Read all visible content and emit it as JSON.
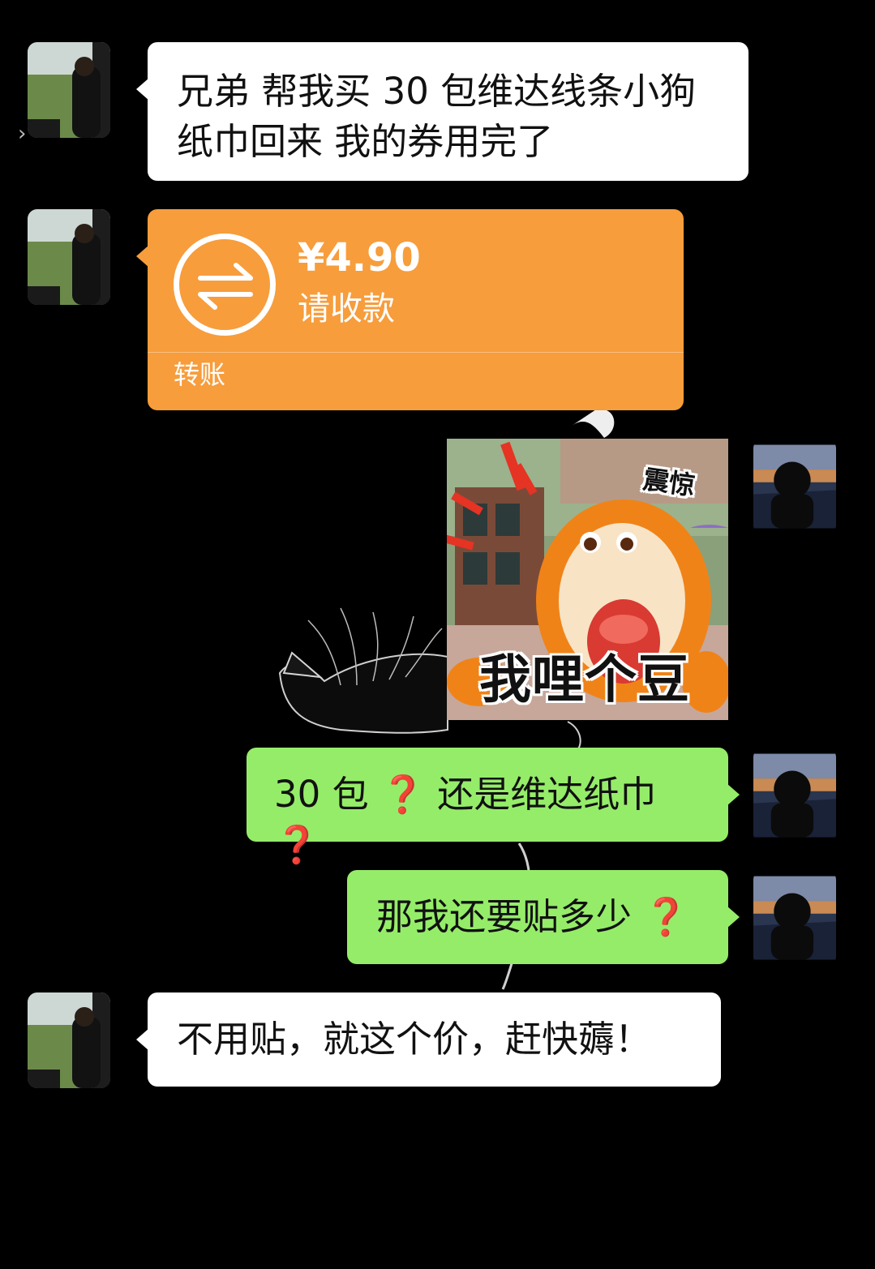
{
  "messages": [
    {
      "id": "m1",
      "side": "left",
      "type": "text",
      "text": "兄弟 帮我买 30 包维达线条小狗\n纸巾回来 我的券用完了"
    },
    {
      "id": "m2",
      "side": "left",
      "type": "transfer",
      "amount": "¥4.90",
      "memo": "请收款",
      "kind": "转账"
    },
    {
      "id": "m3",
      "side": "right",
      "type": "sticker",
      "caption_big": "我哩个豆",
      "caption_small": "震惊"
    },
    {
      "id": "m4",
      "side": "right",
      "type": "text",
      "parts": [
        "30 包",
        "❓",
        "还是维达纸巾",
        "❓"
      ]
    },
    {
      "id": "m5",
      "side": "right",
      "type": "text",
      "parts": [
        "那我还要贴多少",
        "❓"
      ]
    },
    {
      "id": "m6",
      "side": "left",
      "type": "text",
      "text": "不用贴，就这个价，赶快薅！"
    }
  ],
  "colors": {
    "background": "#000000",
    "bubble_incoming": "#ffffff",
    "bubble_outgoing": "#95ec69",
    "transfer": "#f79d3c",
    "question_mark": "#e8212b"
  },
  "icons": {
    "transfer": "transfer-arrows-icon",
    "side": "chevron-right-icon"
  }
}
